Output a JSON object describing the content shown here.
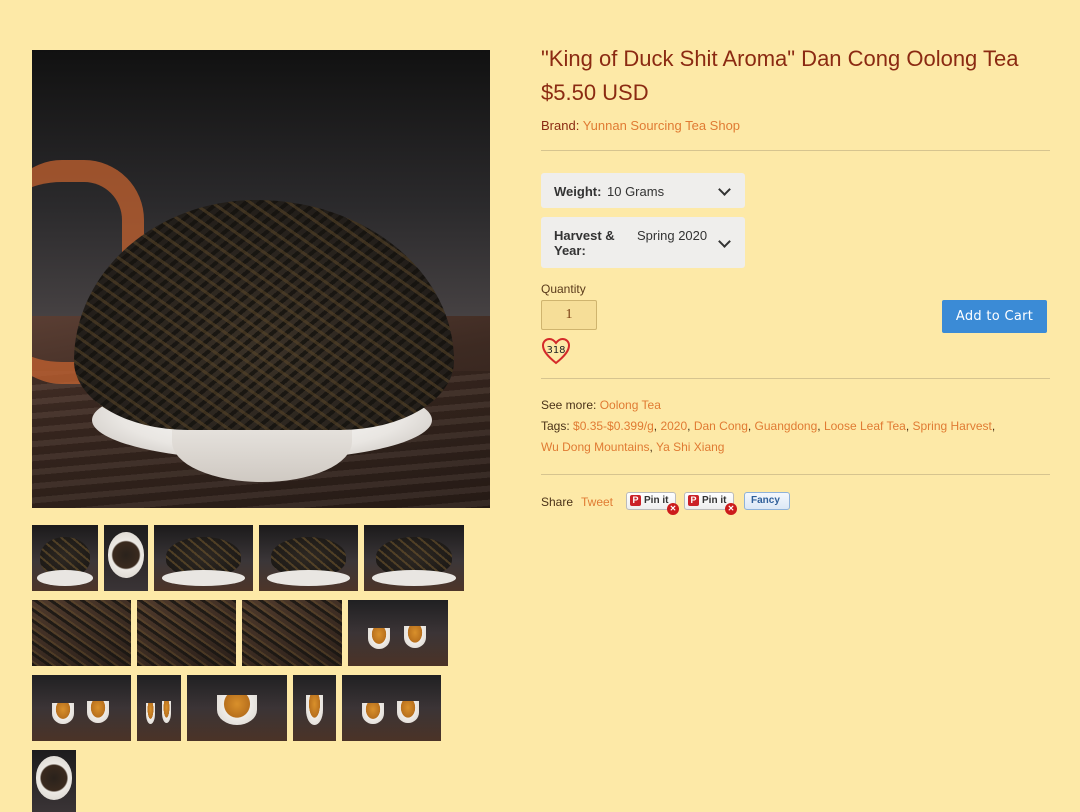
{
  "product": {
    "title": "\"King of Duck Shit Aroma\" Dan Cong Oolong Tea",
    "price": "$5.50 USD",
    "brand_label": "Brand:",
    "brand_value": "Yunnan Sourcing Tea Shop"
  },
  "options": {
    "weight_label": "Weight:",
    "weight_value": "10 Grams",
    "harvest_label_line1": "Harvest &",
    "harvest_label_line2": "Year:",
    "harvest_value": "Spring 2020"
  },
  "purchase": {
    "quantity_label": "Quantity",
    "quantity_value": "1",
    "add_to_cart": "Add to Cart",
    "wishlist_count": "318"
  },
  "meta": {
    "see_more_label": "See more:",
    "see_more_value": "Oolong Tea",
    "tags_label": "Tags:",
    "tags": [
      "$0.35-$0.399/g",
      "2020",
      "Dan Cong",
      "Guangdong",
      "Loose Leaf Tea",
      "Spring Harvest",
      "Wu Dong Mountains",
      "Ya Shi Xiang"
    ]
  },
  "share": {
    "label": "Share",
    "tweet": "Tweet",
    "pin_it": "Pin it",
    "fancy": "Fancy"
  },
  "colors": {
    "background": "#fde9a7",
    "title": "#8b2a12",
    "link": "#e07b33",
    "button": "#3b8bd6"
  }
}
